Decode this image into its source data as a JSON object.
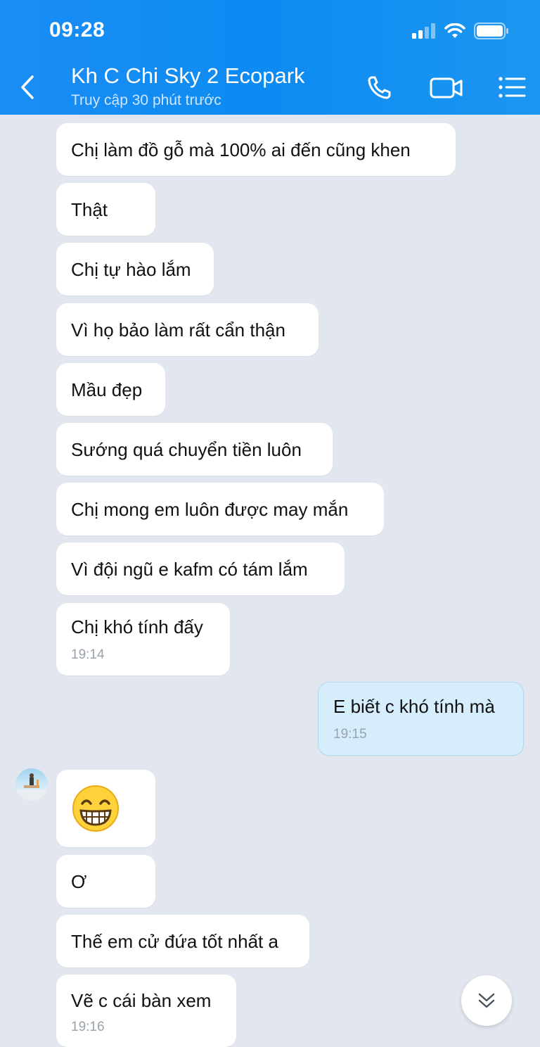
{
  "status_bar": {
    "time": "09:28"
  },
  "header": {
    "title": "Kh C Chi Sky 2 Ecopark",
    "subtitle": "Truy cập 30 phút trước"
  },
  "icons": {
    "back": "back-arrow-icon",
    "call": "phone-icon",
    "video": "video-call-icon",
    "menu": "list-menu-icon",
    "scroll": "double-chevron-down-icon"
  },
  "colors": {
    "header": "#1a8df4",
    "background": "#e2e6ee",
    "outgoing_bubble": "#d6edfc",
    "incoming_bubble": "#ffffff"
  },
  "messages": [
    {
      "text": "Chị làm đồ gỗ mà 100% ai đến cũng khen"
    },
    {
      "text": "Thật"
    },
    {
      "text": "Chị tự hào lắm"
    },
    {
      "text": "Vì họ bảo làm rất cẩn thận"
    },
    {
      "text": "Mầu đẹp"
    },
    {
      "text": "Sướng quá chuyển tiền luôn"
    },
    {
      "text": "Chị mong em luôn được may mắn"
    },
    {
      "text": "Vì đội ngũ e kafm có tám lắm"
    },
    {
      "text": "Chị khó tính đấy",
      "time": "19:14"
    },
    {
      "text": "E biết c khó tính mà",
      "time": "19:15"
    },
    {
      "text": "😁"
    },
    {
      "text": "Ơ"
    },
    {
      "text": "Thế em cử đứa tốt nhất a"
    },
    {
      "text": "Vẽ c cái bàn xem",
      "time": "19:16"
    }
  ]
}
